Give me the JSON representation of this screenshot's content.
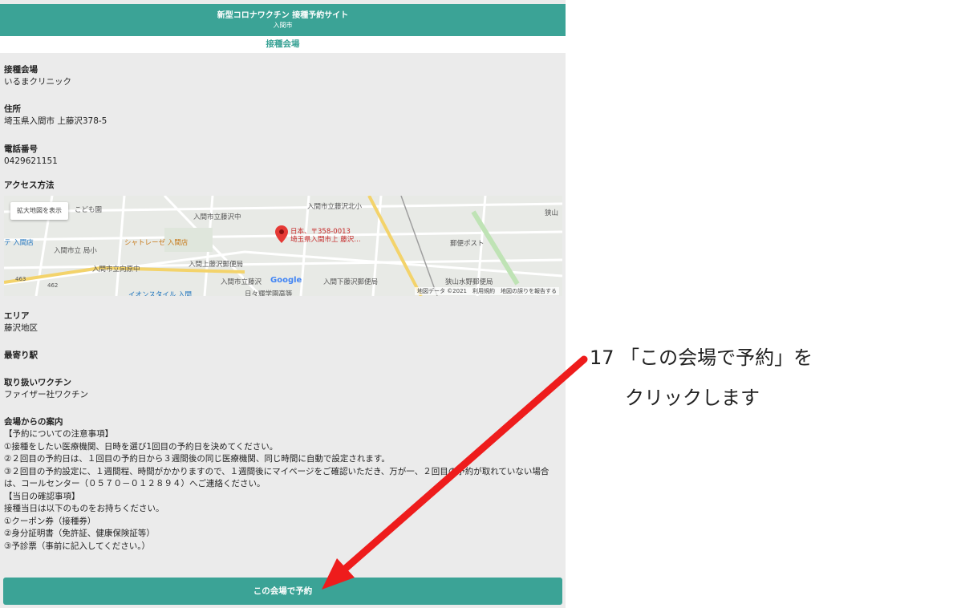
{
  "header": {
    "title": "新型コロナワクチン 接種予約サイト",
    "city": "入間市"
  },
  "section_title": "接種会場",
  "venue": {
    "label": "接種会場",
    "value": "いるまクリニック"
  },
  "address": {
    "label": "住所",
    "value": "埼玉県入間市 上藤沢378-5"
  },
  "phone": {
    "label": "電話番号",
    "value": "0429621151"
  },
  "access": {
    "label": "アクセス方法"
  },
  "map": {
    "enlarge_label": "拡大地図を表示",
    "pin_line1": "日本、〒358-0013",
    "pin_line2": "埼玉県入間市上 藤沢…",
    "labels": {
      "kodomoen": "こども園",
      "iruma_store": "テ 入間店",
      "fujisawa_middle": "入間市立藤沢中",
      "fujisawa_north_elem": "入間市立藤沢北小",
      "chateraise": "シャトレーゼ 入間店",
      "elem_school": "入間市立 局小",
      "mukaihara_middle": "入間市立向原中",
      "kamifujisawa_post": "入間上藤沢郵便局",
      "fujisawa_elem": "入間市立藤沢",
      "shimofujisawa_post": "入間下藤沢郵便局",
      "post_office": "郵便ポスト",
      "sayama": "狭山",
      "sayama_mizuno_post": "狭山水野郵便局",
      "hibino": "日々輝学園高等",
      "aeon": "イオンスタイル 入間",
      "route_463": "463",
      "route_462": "462",
      "google": "Google"
    },
    "footer": "地図データ ©2021　利用規約　地図の誤りを報告する"
  },
  "area": {
    "label": "エリア",
    "value": "藤沢地区"
  },
  "station": {
    "label": "最寄り駅"
  },
  "vaccine": {
    "label": "取り扱いワクチン",
    "value": "ファイザー社ワクチン"
  },
  "notes": {
    "label": "会場からの案内",
    "lines": [
      "【予約についての注意事項】",
      "①接種をしたい医療機関、日時を選び1回目の予約日を決めてください。",
      "②２回目の予約日は、１回目の予約日から３週間後の同じ医療機関、同じ時間に自動で設定されます。",
      "③２回目の予約設定に、１週間程、時間がかかりますので、１週間後にマイページをご確認いただき、万が一、２回目の予約が取れていない場合は、コールセンター（０５７０－０１２８９４）へご連絡ください。",
      "【当日の確認事項】",
      "接種当日は以下のものをお持ちください。",
      "①クーポン券（接種券）",
      "②身分証明書（免許証、健康保険証等）",
      "③予診票（事前に記入してください。）"
    ]
  },
  "reserve_button": "この会場で予約",
  "annotation": {
    "line1": "17 「この会場で予約」を",
    "line2": "クリックします"
  },
  "colors": {
    "accent": "#3ba396",
    "arrow": "#ee1c1c",
    "background": "#ebebeb"
  }
}
